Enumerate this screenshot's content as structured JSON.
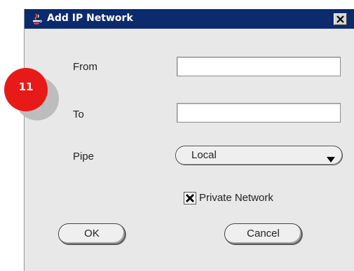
{
  "dialog": {
    "title": "Add IP Network",
    "title_icon": "java-cup-icon",
    "close_icon": "close-icon"
  },
  "form": {
    "from_label": "From",
    "from_value": "",
    "to_label": "To",
    "to_value": "",
    "pipe_label": "Pipe",
    "pipe_selected": "Local",
    "private_network_label": "Private Network",
    "private_network_checked": true
  },
  "buttons": {
    "ok_label": "OK",
    "cancel_label": "Cancel"
  },
  "annotation": {
    "step_number": "11",
    "badge_color": "#e81a17"
  },
  "colors": {
    "titlebar": "#0c2a6e",
    "dialog_background": "#e8e8e8"
  }
}
